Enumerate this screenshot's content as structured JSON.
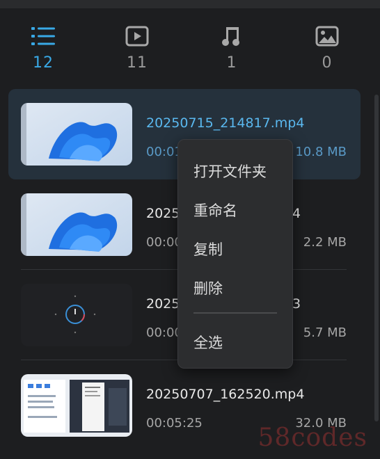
{
  "filters": [
    {
      "icon": "list-icon",
      "count": "12"
    },
    {
      "icon": "video-icon",
      "count": "11"
    },
    {
      "icon": "music-note-icon",
      "count": "1"
    },
    {
      "icon": "image-icon",
      "count": "0"
    }
  ],
  "items": [
    {
      "name": "20250715_214817.mp4",
      "duration": "00:01",
      "size": "10.8 MB",
      "thumb": "windows-wallpaper"
    },
    {
      "name": "2025",
      "name_tail": "4",
      "duration": "00:00",
      "size": "2.2 MB",
      "thumb": "windows-wallpaper"
    },
    {
      "name": "2025",
      "name_tail": "3",
      "duration": "00:00",
      "size": "5.7 MB",
      "thumb": "dark-clock"
    },
    {
      "name": "20250707_162520.mp4",
      "duration": "00:05:25",
      "size": "32.0 MB",
      "thumb": "desktop-screenshot"
    }
  ],
  "context_menu": {
    "items": [
      "打开文件夹",
      "重命名",
      "复制",
      "删除",
      "全选"
    ]
  },
  "watermark": "58codes",
  "colors": {
    "accent": "#39a9e6",
    "selected_bg": "#25313c",
    "menu_bg": "#2c2d2f"
  }
}
